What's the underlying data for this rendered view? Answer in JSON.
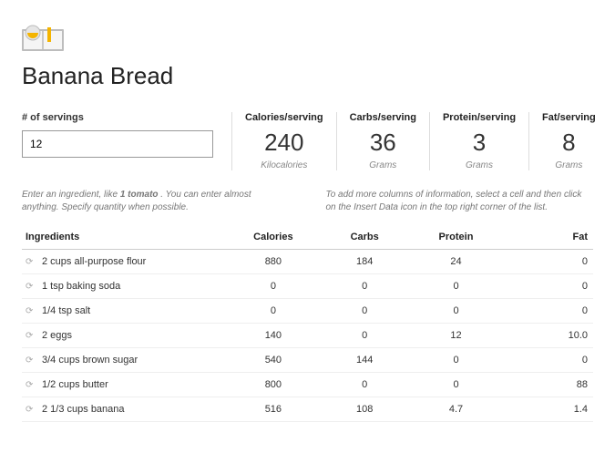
{
  "title": "Banana Bread",
  "servings": {
    "label": "# of servings",
    "value": "12"
  },
  "stats": [
    {
      "label": "Calories/serving",
      "value": "240",
      "unit": "Kilocalories"
    },
    {
      "label": "Carbs/serving",
      "value": "36",
      "unit": "Grams"
    },
    {
      "label": "Protein/serving",
      "value": "3",
      "unit": "Grams"
    },
    {
      "label": "Fat/serving",
      "value": "8",
      "unit": "Grams"
    }
  ],
  "hints": {
    "left_a": "Enter an ingredient, like ",
    "left_b": "1 tomato",
    "left_c": " . You can enter almost anything. Specify quantity when possible.",
    "right": "To add more columns of information, select a cell and then click on the Insert Data icon in the top right corner of the list."
  },
  "table": {
    "headers": [
      "Ingredients",
      "Calories",
      "Carbs",
      "Protein",
      "Fat"
    ],
    "rows": [
      {
        "name": "2 cups all-purpose flour",
        "calories": "880",
        "carbs": "184",
        "protein": "24",
        "fat": "0"
      },
      {
        "name": "1 tsp baking soda",
        "calories": "0",
        "carbs": "0",
        "protein": "0",
        "fat": "0"
      },
      {
        "name": "1/4 tsp salt",
        "calories": "0",
        "carbs": "0",
        "protein": "0",
        "fat": "0"
      },
      {
        "name": "2 eggs",
        "calories": "140",
        "carbs": "0",
        "protein": "12",
        "fat": "10.0"
      },
      {
        "name": "3/4 cups brown sugar",
        "calories": "540",
        "carbs": "144",
        "protein": "0",
        "fat": "0"
      },
      {
        "name": "1/2 cups butter",
        "calories": "800",
        "carbs": "0",
        "protein": "0",
        "fat": "88"
      },
      {
        "name": "2 1/3 cups banana",
        "calories": "516",
        "carbs": "108",
        "protein": "4.7",
        "fat": "1.4"
      }
    ]
  }
}
